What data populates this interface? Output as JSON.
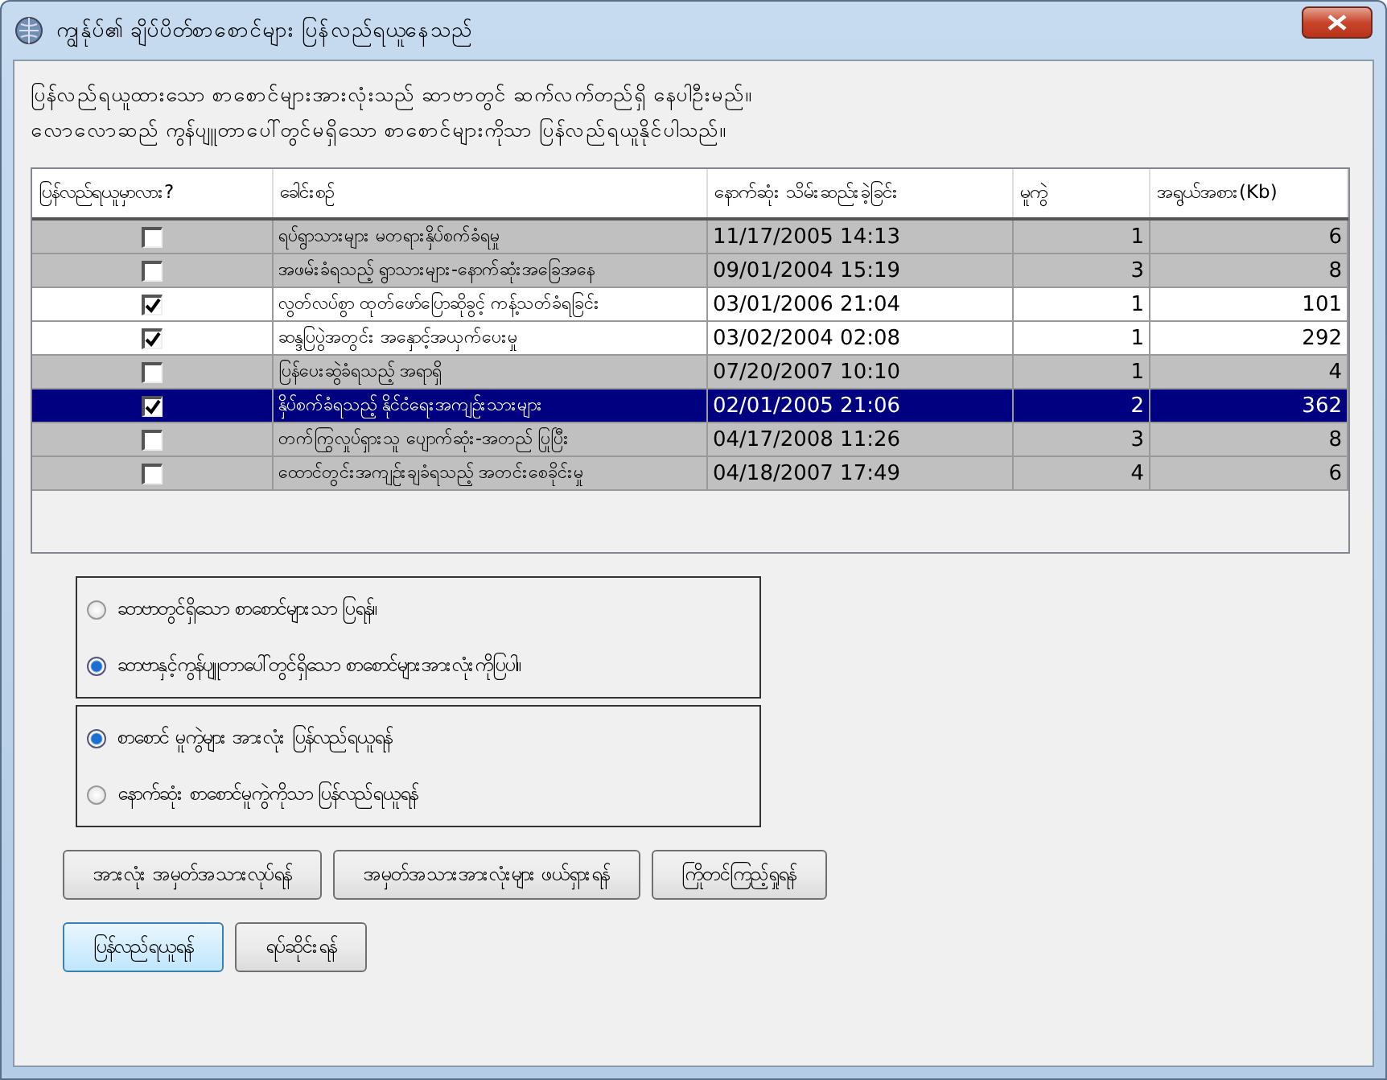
{
  "window": {
    "title": "ကျွန်ုပ်၏ ချိပ်ပိတ်စာစောင်များ ပြန်လည်ရယူနေသည်"
  },
  "intro": [
    "ပြန်လည်ရယူထားသော စာစောင်များအားလုံးသည် ဆာဗာတွင် ဆက်လက်တည်ရှိ နေပါဦးမည်။",
    "လောလောဆည် ကွန်ပျူတာပေါ်တွင်မရှိသော စာစောင်များကိုသာ ပြန်လည်ရယူနိုင်ပါသည်။"
  ],
  "table": {
    "columns": [
      "ပြန်လည်ရယူမှာလား?",
      "ခေါင်းစဉ်",
      "နောက်ဆုံး သိမ်းဆည်းခဲ့ခြင်း",
      "မူကွဲ",
      "အရွယ်အစား(Kb)"
    ],
    "rows": [
      {
        "checked": false,
        "selected": false,
        "title": "ရပ်ရွာသားများ မတရားနှိပ်စက်ခံရမှု",
        "saved": "11/17/2005  14:13",
        "version": "1",
        "size": "6"
      },
      {
        "checked": false,
        "selected": false,
        "title": "အဖမ်းခံရသည့် ရွာသားများ-နောက်ဆုံးအခြေအနေ",
        "saved": "09/01/2004  15:19",
        "version": "3",
        "size": "8"
      },
      {
        "checked": true,
        "selected": false,
        "title": "လွတ်လပ်စွာ ထုတ်ဖော်ပြောဆိုခွင့် ကန့်သတ်ခံရခြင်း",
        "saved": "03/01/2006  21:04",
        "version": "1",
        "size": "101"
      },
      {
        "checked": true,
        "selected": false,
        "title": "ဆန္ဒပြပွဲအတွင်း အနှောင့်အယှက်ပေးမှု",
        "saved": "03/02/2004  02:08",
        "version": "1",
        "size": "292"
      },
      {
        "checked": false,
        "selected": false,
        "title": "ပြန်ပေးဆွဲခံရသည့် အရာရှိ",
        "saved": "07/20/2007  10:10",
        "version": "1",
        "size": "4"
      },
      {
        "checked": true,
        "selected": true,
        "title": "နှိပ်စက်ခံရသည့် နိုင်ငံရေးအကျဉ်းသားများ",
        "saved": "02/01/2005  21:06",
        "version": "2",
        "size": "362"
      },
      {
        "checked": false,
        "selected": false,
        "title": "တက်ကြွလှုပ်ရှားသူ ပျောက်ဆုံး-အတည် ပြုပြီး",
        "saved": "04/17/2008  11:26",
        "version": "3",
        "size": "8"
      },
      {
        "checked": false,
        "selected": false,
        "title": "ထောင်တွင်းအကျဉ်းချခံရသည့် အတင်းစေခိုင်းမှု",
        "saved": "04/18/2007  17:49",
        "version": "4",
        "size": "6"
      }
    ]
  },
  "show_options": [
    {
      "label": "ဆာဗာတွင်ရှိသော စာစောင်များသာ ပြရန်။",
      "selected": false
    },
    {
      "label": "ဆာဗာနှင့်ကွန်ပျူတာပေါ်တွင်ရှိသော စာစောင်များအားလုံးကိုပြပါ။",
      "selected": true
    }
  ],
  "version_options": [
    {
      "label": "စာစောင် မူကွဲများ အားလုံး ပြန်လည်ရယူရန်",
      "selected": true
    },
    {
      "label": "နောက်ဆုံး စာစောင်မူကွဲကိုသာ ပြန်လည်ရယူရန်",
      "selected": false
    }
  ],
  "buttons_row1": [
    {
      "label": "အားလုံး အမှတ်အသားလုပ်ရန်",
      "default": false
    },
    {
      "label": "အမှတ်အသားအားလုံးများ ဖယ်ရှားရန်",
      "default": false
    },
    {
      "label": "ကြိုတင်ကြည့်ရှုရန်",
      "default": false
    }
  ],
  "buttons_row2": [
    {
      "label": "ပြန်လည်ရယူရန်",
      "default": true
    },
    {
      "label": "ရပ်ဆိုင်းရန်",
      "default": false
    }
  ]
}
